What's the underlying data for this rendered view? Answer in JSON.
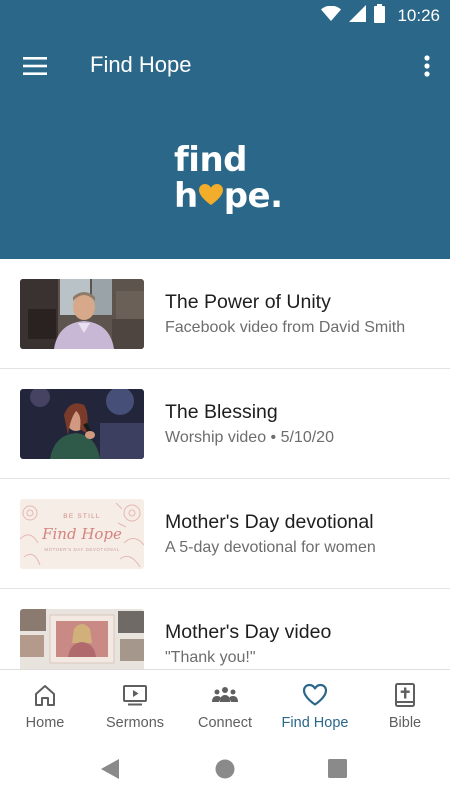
{
  "status_bar": {
    "time": "10:26",
    "icons": [
      "wifi-icon",
      "cell-signal-icon",
      "battery-icon"
    ]
  },
  "app_bar": {
    "title": "Find Hope",
    "menu_icon": "hamburger-menu-icon",
    "overflow_icon": "more-vert-icon"
  },
  "banner": {
    "logo_line1": "find",
    "logo_line2_start": "h",
    "logo_line2_end": "pe.",
    "logo_icon": "heart-icon"
  },
  "items": [
    {
      "title": "The Power of Unity",
      "subtitle": "Facebook video from David Smith",
      "thumbnail": "speaker-video-thumbnail"
    },
    {
      "title": "The Blessing",
      "subtitle": "Worship video • 5/10/20",
      "thumbnail": "worship-singer-thumbnail"
    },
    {
      "title": "Mother's Day devotional",
      "subtitle": "A 5-day devotional for women",
      "thumbnail": "devotional-card-thumbnail",
      "thumb_text": {
        "line1": "BE STILL",
        "line2": "Find Hope",
        "line3": "MOTHER'S DAY DEVOTIONAL"
      }
    },
    {
      "title": "Mother's Day video",
      "subtitle": "\"Thank you!\"",
      "thumbnail": "video-collage-thumbnail"
    }
  ],
  "bottom_nav": [
    {
      "label": "Home",
      "icon": "home-icon",
      "active": false
    },
    {
      "label": "Sermons",
      "icon": "video-monitor-icon",
      "active": false
    },
    {
      "label": "Connect",
      "icon": "people-group-icon",
      "active": false
    },
    {
      "label": "Find Hope",
      "icon": "heart-outline-icon",
      "active": true
    },
    {
      "label": "Bible",
      "icon": "bible-cross-icon",
      "active": false
    }
  ],
  "colors": {
    "brand": "#2b6788",
    "accent_heart": "#f2ae2a",
    "active_nav": "#2b6788",
    "inactive_nav": "#5f5f5f"
  },
  "system_nav": [
    "back-icon",
    "home-circle-icon",
    "recents-icon"
  ]
}
